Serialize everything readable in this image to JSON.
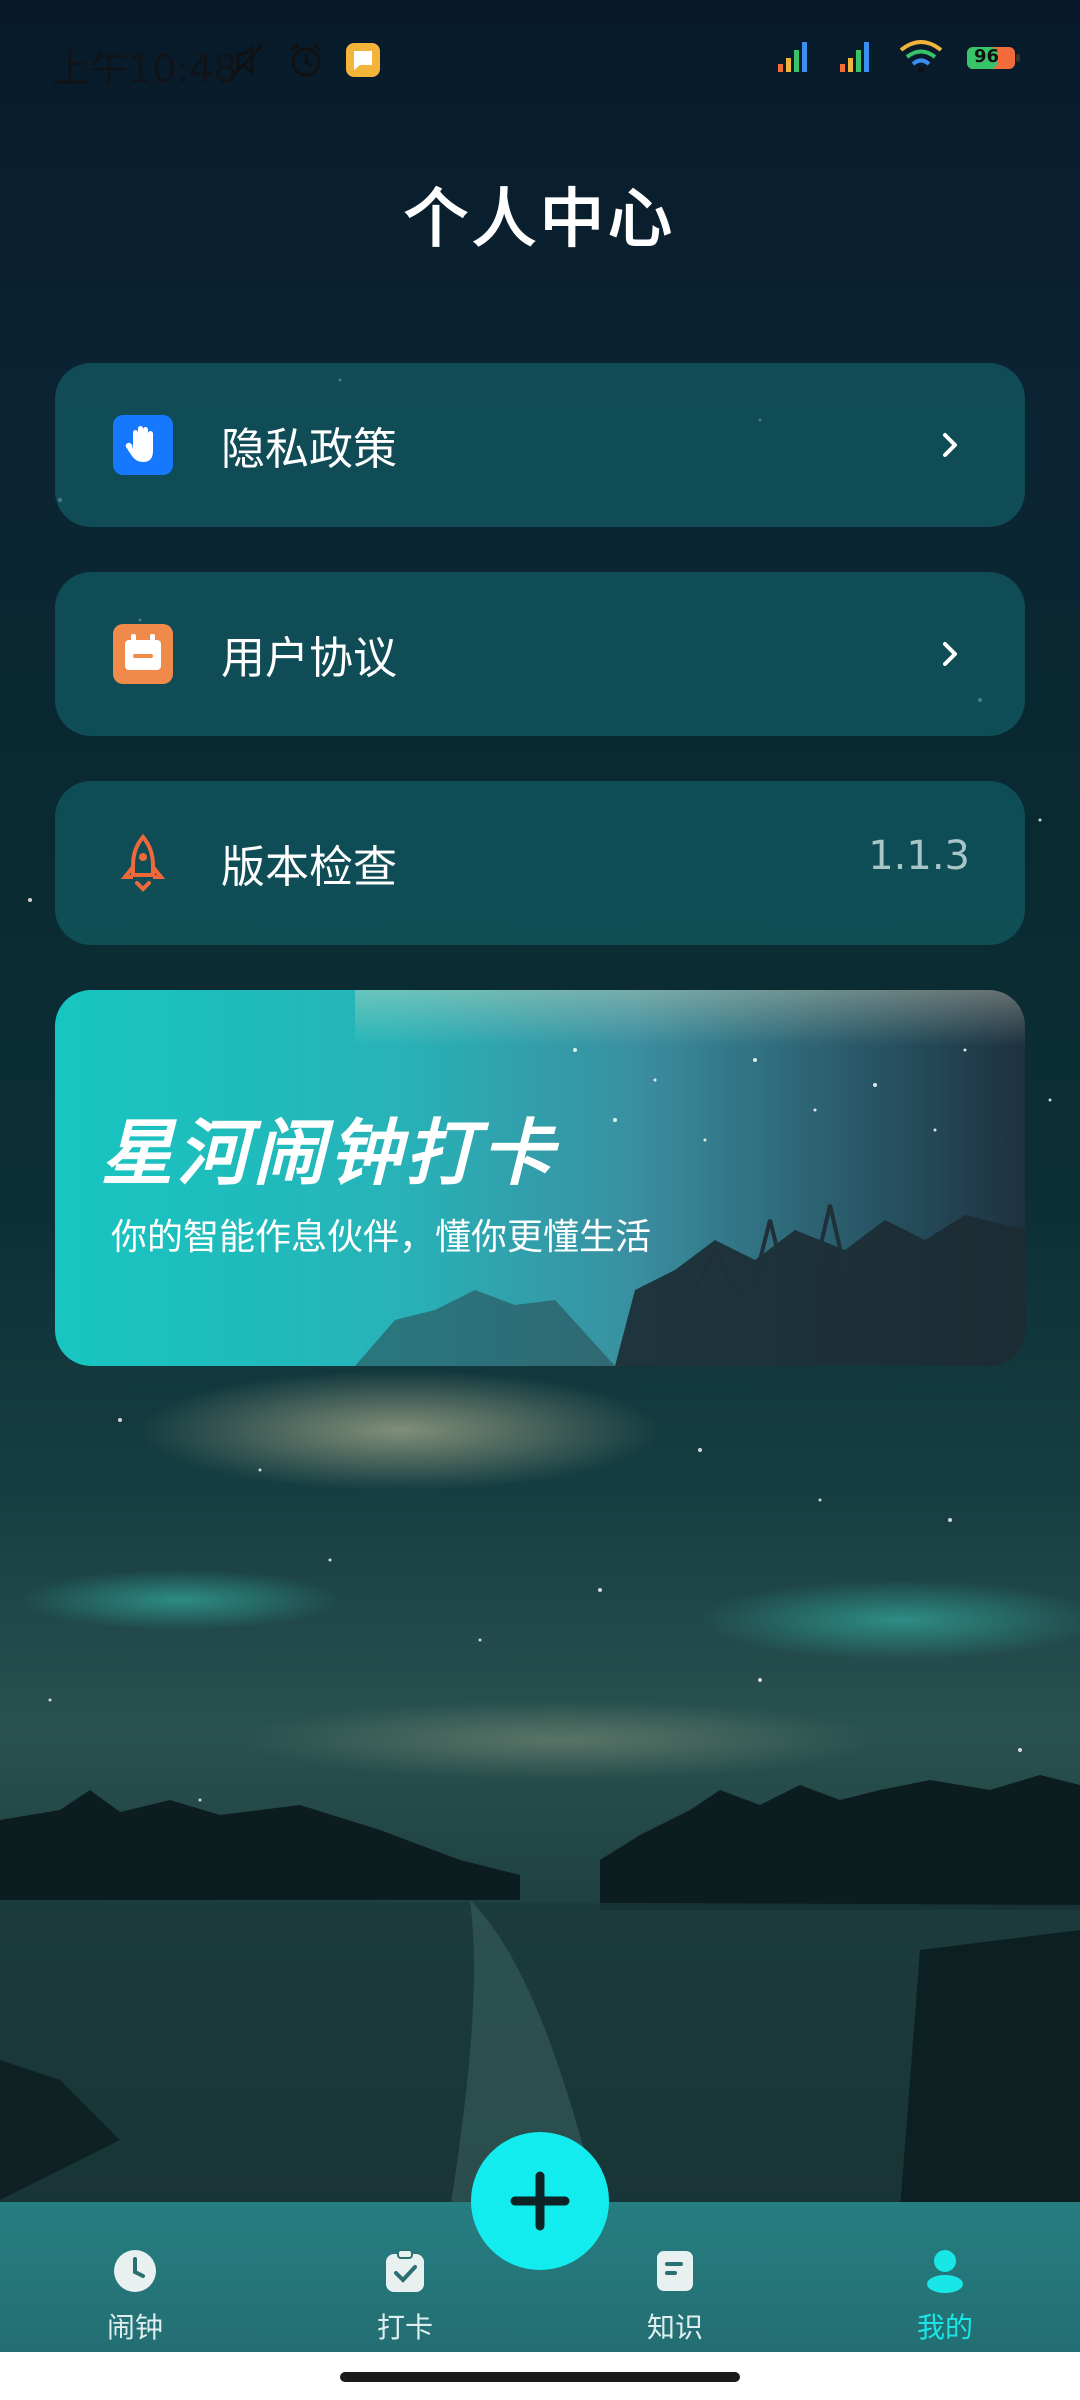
{
  "status_bar": {
    "time": "上午10:48",
    "battery": "96"
  },
  "page": {
    "title": "个人中心"
  },
  "menu": {
    "items": [
      {
        "label": "隐私政策",
        "icon": "hand-icon",
        "color": "#1677ff"
      },
      {
        "label": "用户协议",
        "icon": "calendar-icon",
        "color": "#f08a4b"
      },
      {
        "label": "版本检查",
        "icon": "rocket-icon",
        "color": "#f0683a",
        "value": "1.1.3"
      }
    ]
  },
  "banner": {
    "title": "星河闹钟打卡",
    "subtitle": "你的智能作息伙伴，懂你更懂生活"
  },
  "tabbar": {
    "items": [
      {
        "label": "闹钟",
        "icon": "clock-icon"
      },
      {
        "label": "打卡",
        "icon": "checkin-icon"
      },
      {
        "label": "知识",
        "icon": "book-icon"
      },
      {
        "label": "我的",
        "icon": "user-icon",
        "active": true
      }
    ],
    "fab_icon": "plus-icon"
  },
  "colors": {
    "accent": "#12ecee",
    "tab_bg": "#267e80",
    "card_bg": "#125c64"
  }
}
